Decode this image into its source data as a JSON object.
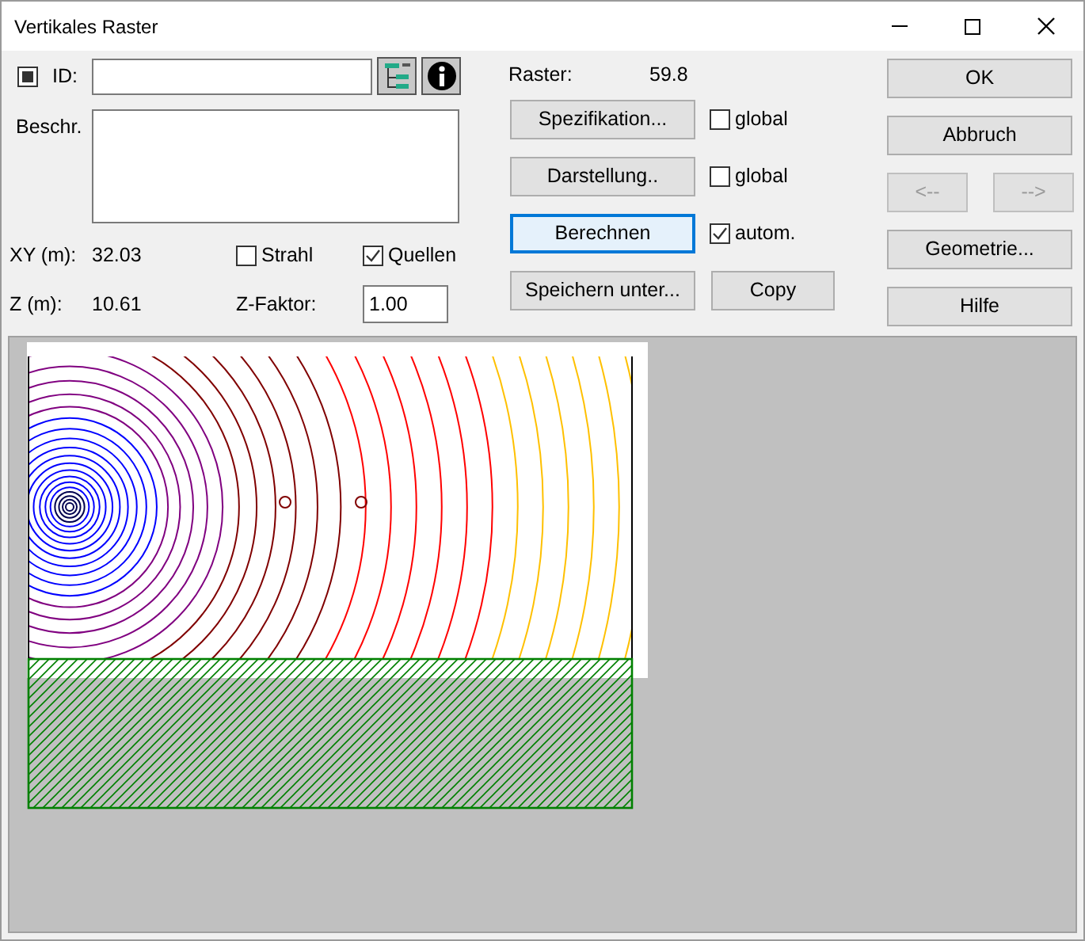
{
  "window": {
    "title": "Vertikales Raster"
  },
  "id_field": {
    "label": "ID:",
    "indeterminate": true
  },
  "description": {
    "label": "Beschr."
  },
  "xy": {
    "label": "XY (m):",
    "value": "32.03"
  },
  "z": {
    "label": "Z (m):",
    "value": "10.61"
  },
  "options": [
    {
      "label": "Strahl",
      "checked": false
    },
    {
      "label": "Quellen",
      "checked": true
    }
  ],
  "z_factor": {
    "label": "Z-Faktor:",
    "value": "1.00"
  },
  "raster": {
    "label": "Raster:",
    "value": "59.8"
  },
  "action_rows": [
    {
      "button": "Spezifikation...",
      "focused": false,
      "checkbox": {
        "label": "global",
        "checked": false
      }
    },
    {
      "button": "Darstellung..",
      "focused": false,
      "checkbox": {
        "label": "global",
        "checked": false
      }
    },
    {
      "button": "Berechnen",
      "focused": true,
      "checkbox": {
        "label": "autom.",
        "checked": true
      }
    },
    {
      "button": "Speichern unter...",
      "focused": false,
      "side_button": "Copy"
    }
  ],
  "right_buttons": [
    {
      "kind": "single",
      "items": [
        {
          "label": "OK",
          "disabled": false
        }
      ]
    },
    {
      "kind": "single",
      "items": [
        {
          "label": "Abbruch",
          "disabled": false
        }
      ]
    },
    {
      "kind": "pair",
      "items": [
        {
          "label": "<--",
          "disabled": true
        },
        {
          "label": "-->",
          "disabled": true
        }
      ]
    },
    {
      "kind": "single",
      "items": [
        {
          "label": "Geometrie...",
          "disabled": false
        }
      ]
    },
    {
      "kind": "single",
      "items": [
        {
          "label": "Hilfe",
          "disabled": false
        }
      ]
    }
  ]
}
